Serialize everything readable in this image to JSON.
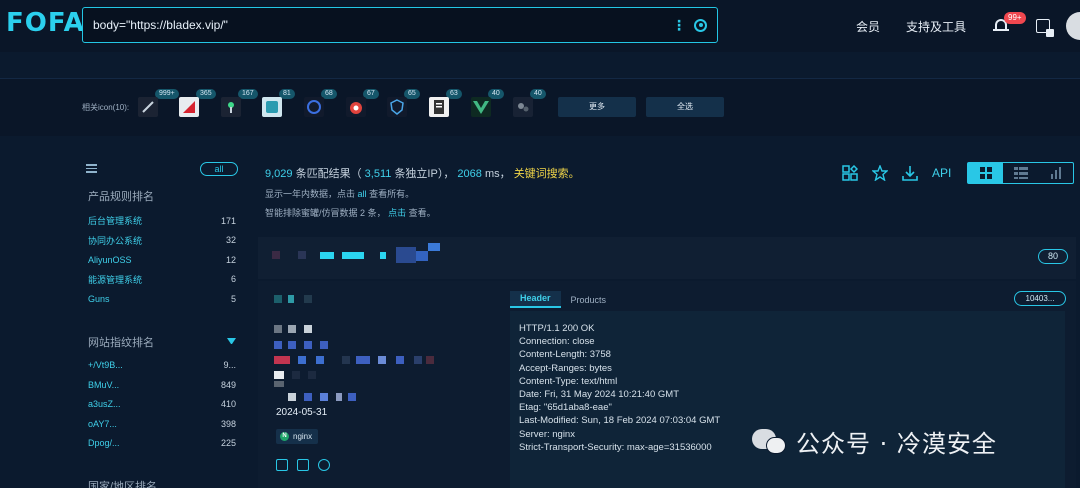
{
  "header": {
    "logo": "FOFA",
    "query": "body=\"https://bladex.vip/\"",
    "nav": [
      "会员",
      "支持及工具"
    ],
    "notification_badge": "99+"
  },
  "icon_row": {
    "label": "相关icon(10):",
    "counts": [
      "999+",
      "365",
      "167",
      "81",
      "68",
      "67",
      "65",
      "63",
      "40",
      "40"
    ],
    "more_label": "更多",
    "select_all_label": "全选"
  },
  "sidebar": {
    "all_label": "all",
    "product_title": "产品规则排名",
    "products": [
      {
        "name": "后台管理系统",
        "count": "171"
      },
      {
        "name": "协同办公系统",
        "count": "32"
      },
      {
        "name": "AliyunOSS",
        "count": "12"
      },
      {
        "name": "能源管理系统",
        "count": "6"
      },
      {
        "name": "Guns",
        "count": "5"
      }
    ],
    "fingerprint_title": "网站指纹排名",
    "fingerprints": [
      {
        "name": "+/Vt9B...",
        "count": "9..."
      },
      {
        "name": "BMuV...",
        "count": "849"
      },
      {
        "name": "a3usZ...",
        "count": "410"
      },
      {
        "name": "oAY7...",
        "count": "398"
      },
      {
        "name": "Dpog/...",
        "count": "225"
      }
    ],
    "country_title": "国家/地区排名"
  },
  "summary": {
    "results": "9,029",
    "results_text": "条匹配结果（",
    "ips": "3,511",
    "ips_text": "条独立IP），",
    "ms": "2068",
    "ms_text": "ms，",
    "keyword_link": "关键词搜索。",
    "line2_pre": "显示一年内数据，点击",
    "line2_link": "all",
    "line2_post": "查看所有。",
    "line3_pre": "智能排除蜜罐/仿冒数据",
    "line3_num": "2",
    "line3_mid": "条，",
    "line3_link": "点击",
    "line3_post": "查看。",
    "api_label": "API"
  },
  "result": {
    "port": "80",
    "date": "2024-05-31",
    "server_tag": "nginx",
    "tabs": [
      "Header",
      "Products"
    ],
    "version_pill": "10403...",
    "header_lines": [
      "HTTP/1.1 200 OK",
      "Connection: close",
      "Content-Length: 3758",
      "Accept-Ranges: bytes",
      "Content-Type: text/html",
      "Date: Fri, 31 May 2024 10:21:40 GMT",
      "Etag: \"65d1aba8-eae\"",
      "Last-Modified: Sun, 18 Feb 2024 07:03:04 GMT",
      "Server: nginx",
      "Strict-Transport-Security: max-age=31536000"
    ]
  },
  "watermark": "公众号 · 冷漠安全",
  "colors": {
    "accent": "#29c7e6",
    "background": "#0b1a2e",
    "highlight": "#f0d548"
  }
}
